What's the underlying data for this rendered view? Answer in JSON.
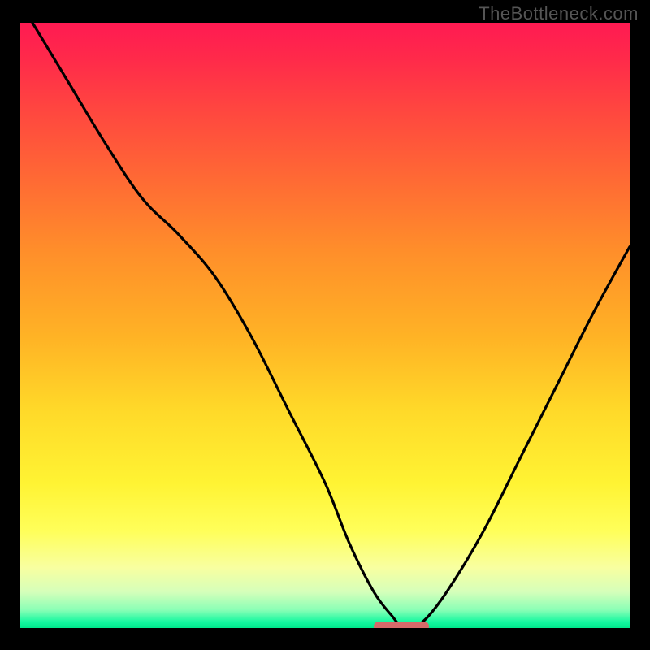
{
  "watermark": "TheBottleneck.com",
  "colors": {
    "frame_bg": "#000000",
    "curve": "#000000",
    "marker": "#d66a6a",
    "gradient_top": "#ff1a52",
    "gradient_bottom": "#00e88c"
  },
  "chart_data": {
    "type": "line",
    "title": "",
    "xlabel": "",
    "ylabel": "",
    "xlim": [
      0,
      100
    ],
    "ylim": [
      0,
      100
    ],
    "series": [
      {
        "name": "bottleneck-curve",
        "x": [
          2,
          8,
          14,
          20,
          26,
          32,
          38,
          44,
          50,
          54,
          58,
          61,
          63,
          66,
          70,
          76,
          82,
          88,
          94,
          100
        ],
        "y": [
          100,
          90,
          80,
          71,
          65,
          58,
          48,
          36,
          24,
          14,
          6,
          2,
          0,
          1,
          6,
          16,
          28,
          40,
          52,
          63
        ]
      }
    ],
    "annotations": [
      {
        "name": "optimal-marker",
        "x_start": 58,
        "x_end": 67,
        "y": 0
      }
    ],
    "background": "vertical-gradient red→orange→yellow→green (top=high bottleneck, bottom=0)"
  }
}
